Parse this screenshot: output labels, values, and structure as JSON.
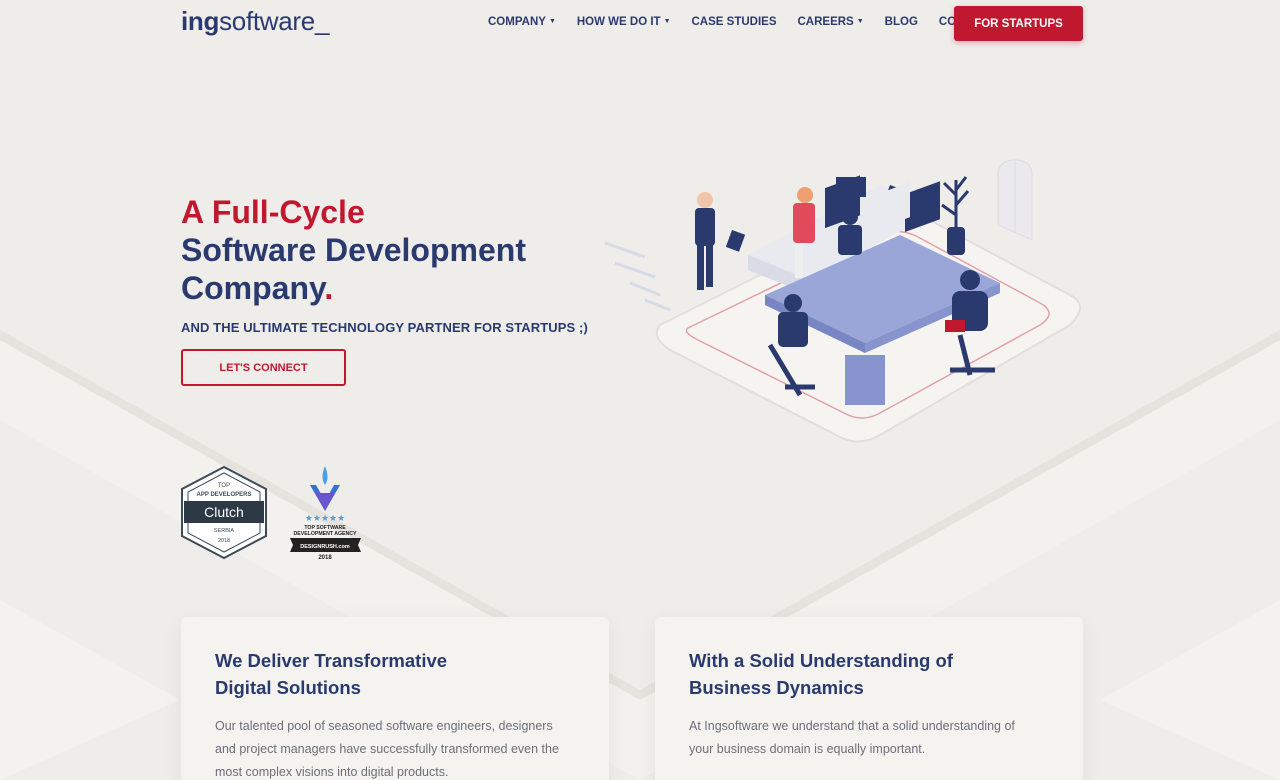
{
  "brand": {
    "logo_bold": "ing",
    "logo_rest": "software_",
    "accent_color": "#c0192f",
    "navy_color": "#2b3a6e"
  },
  "nav": {
    "items": [
      {
        "label": "COMPANY",
        "dropdown": true
      },
      {
        "label": "HOW WE DO IT",
        "dropdown": true
      },
      {
        "label": "CASE STUDIES",
        "dropdown": false
      },
      {
        "label": "CAREERS",
        "dropdown": true
      },
      {
        "label": "BLOG",
        "dropdown": false
      },
      {
        "label": "CONTACT",
        "dropdown": false
      }
    ],
    "cta_label": "FOR STARTUPS"
  },
  "hero": {
    "title_line1": "A Full-Cycle",
    "title_line2": "Software Development",
    "title_line3": "Company",
    "title_dot": ".",
    "subtitle": "AND THE ULTIMATE TECHNOLOGY PARTNER FOR STARTUPS ;)",
    "button_label": "LET'S CONNECT"
  },
  "badges": {
    "clutch": {
      "top": "TOP",
      "category": "APP DEVELOPERS",
      "brand": "Clutch",
      "region": "SERBIA",
      "year": "2018"
    },
    "designrush": {
      "line1": "TOP SOFTWARE",
      "line2": "DEVELOPMENT AGENCY",
      "brand": "DESIGNRUSH.com",
      "year": "2018",
      "stars": "★★★★★"
    }
  },
  "cards": [
    {
      "title": "We Deliver Transformative\nDigital Solutions",
      "body": "Our talented pool of seasoned software engineers, designers\nand project managers have successfully transformed even the\nmost complex visions into digital products."
    },
    {
      "title": "With a Solid Understanding of\nBusiness Dynamics",
      "body": "At Ingsoftware we understand that a solid understanding of\nyour business domain is equally important."
    }
  ]
}
